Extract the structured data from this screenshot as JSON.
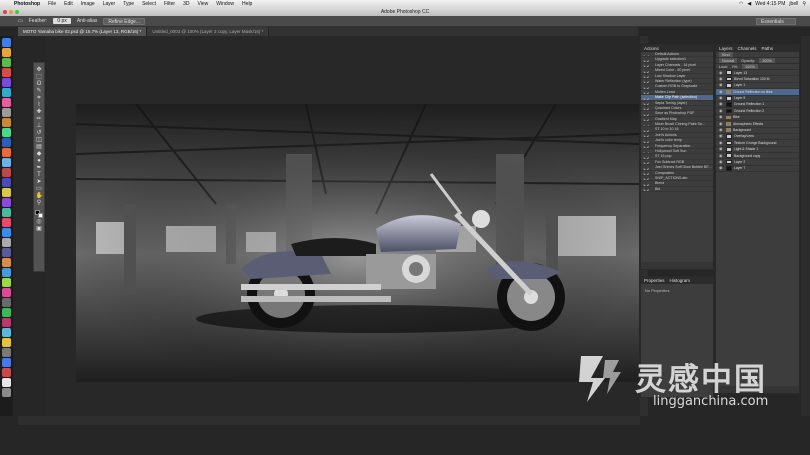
{
  "menubar": {
    "app": "Photoshop",
    "items": [
      "File",
      "Edit",
      "Image",
      "Layer",
      "Type",
      "Select",
      "Filter",
      "3D",
      "View",
      "Window",
      "Help"
    ],
    "clock": "Wed 4:15 PM",
    "user": "jbell"
  },
  "window": {
    "title": "Adobe Photoshop CC"
  },
  "options": {
    "feather_label": "Feather:",
    "feather_value": "0 px",
    "antialias_label": "Anti-alias",
    "refine_button": "Refine Edge...",
    "workspace": "Essentials"
  },
  "doc_tabs": [
    {
      "label": "MOTO Yamaha bike 02.psd @ 16.7% (Layer 13, RGB/16) *"
    },
    {
      "label": "Untitled_0003 @ 100% (Layer 3 copy, Layer Mask/16) *"
    }
  ],
  "actions_panel": {
    "tabs": [
      "Actions"
    ],
    "rows": [
      "Default Actions",
      "Upgrade selection1",
      "Layer Channels - 16 pixel",
      "Mixed Color - 50 pixel",
      "Low Shadow Layer",
      "Water Reflection (type)",
      "Custom RGB to Grayscale",
      "Molten Lead",
      "Make Clip Path (selection)",
      "Sepia Toning (layer)",
      "Quadrant Colors",
      "Save as Photoshop PDF",
      "Gradient Map",
      "Mixer Brush Cloning Paint Se...",
      "ST 10 to 10 16",
      "Joel's Actions",
      "Joel's color temp",
      "Frequency Separation",
      "Hollywood Soft Sun",
      "ST 16 pop",
      "Fox Subtract RGB",
      "Joel Grimes Soft Glow Bubble BE...",
      "Composites",
      "SNIP_ACTIONS.atn",
      "Blend",
      "Bld"
    ],
    "selected_index": 8
  },
  "properties_panel": {
    "tabs": [
      "Properties",
      "Histogram"
    ],
    "empty_text": "No Properties"
  },
  "layers_panel": {
    "tabs": [
      "Layers",
      "Channels",
      "Paths"
    ],
    "kind": "Kind",
    "blend_mode": "Normal",
    "opacity_label": "Opacity:",
    "opacity": "100%",
    "lock_label": "Lock:",
    "fill_label": "Fill:",
    "fill": "100%",
    "rows": [
      {
        "name": "Layer 13",
        "kind": "thumb",
        "selected": false
      },
      {
        "name": "Blend Saturation 100 M",
        "kind": "thumb",
        "selected": false
      },
      {
        "name": "Layer 1",
        "kind": "thumb",
        "selected": false
      },
      {
        "name": "Ground Reflection on Bike",
        "kind": "group",
        "selected": true
      },
      {
        "name": "Layer 9",
        "kind": "thumb",
        "selected": false
      },
      {
        "name": "Ground Reflection 1",
        "kind": "dark",
        "selected": false
      },
      {
        "name": "Ground Reflection 2",
        "kind": "dark",
        "selected": false
      },
      {
        "name": "Bike",
        "kind": "group",
        "selected": false
      },
      {
        "name": "Atmospheric Effects",
        "kind": "group",
        "selected": false
      },
      {
        "name": "Background",
        "kind": "group",
        "selected": false
      },
      {
        "name": "Overlay/Lens",
        "kind": "thumb",
        "selected": false
      },
      {
        "name": "Texture Grunge Background",
        "kind": "thumb",
        "selected": false
      },
      {
        "name": "Light & Shade 1",
        "kind": "thumb",
        "selected": false
      },
      {
        "name": "Background copy",
        "kind": "thumb",
        "selected": false
      },
      {
        "name": "Layer 2",
        "kind": "thumb",
        "selected": false
      },
      {
        "name": "Layer 7",
        "kind": "dark",
        "selected": false
      }
    ]
  },
  "watermark": {
    "brand_cn": "灵感中国",
    "url": "lingganchina.com"
  },
  "colors": {
    "ui_dark": "#262626",
    "panel": "#3d3d3d",
    "selection": "#4d6a8e"
  }
}
